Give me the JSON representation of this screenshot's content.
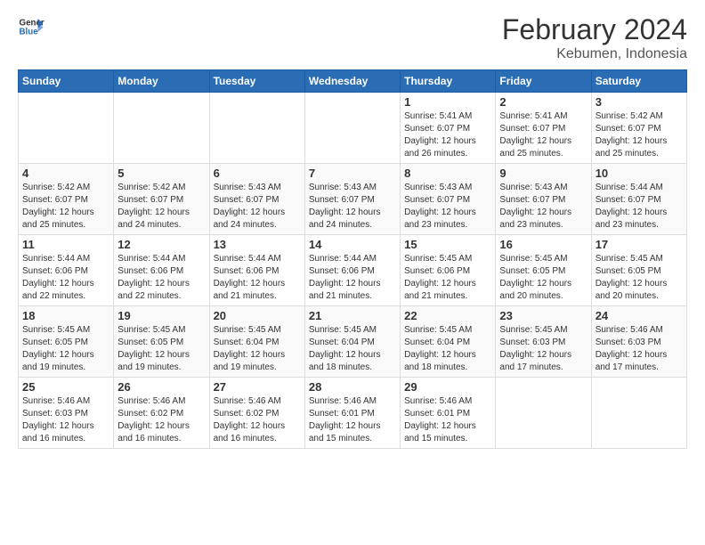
{
  "logo": {
    "line1": "General",
    "line2": "Blue"
  },
  "title": "February 2024",
  "location": "Kebumen, Indonesia",
  "days_of_week": [
    "Sunday",
    "Monday",
    "Tuesday",
    "Wednesday",
    "Thursday",
    "Friday",
    "Saturday"
  ],
  "weeks": [
    [
      {
        "day": "",
        "info": ""
      },
      {
        "day": "",
        "info": ""
      },
      {
        "day": "",
        "info": ""
      },
      {
        "day": "",
        "info": ""
      },
      {
        "day": "1",
        "info": "Sunrise: 5:41 AM\nSunset: 6:07 PM\nDaylight: 12 hours\nand 26 minutes."
      },
      {
        "day": "2",
        "info": "Sunrise: 5:41 AM\nSunset: 6:07 PM\nDaylight: 12 hours\nand 25 minutes."
      },
      {
        "day": "3",
        "info": "Sunrise: 5:42 AM\nSunset: 6:07 PM\nDaylight: 12 hours\nand 25 minutes."
      }
    ],
    [
      {
        "day": "4",
        "info": "Sunrise: 5:42 AM\nSunset: 6:07 PM\nDaylight: 12 hours\nand 25 minutes."
      },
      {
        "day": "5",
        "info": "Sunrise: 5:42 AM\nSunset: 6:07 PM\nDaylight: 12 hours\nand 24 minutes."
      },
      {
        "day": "6",
        "info": "Sunrise: 5:43 AM\nSunset: 6:07 PM\nDaylight: 12 hours\nand 24 minutes."
      },
      {
        "day": "7",
        "info": "Sunrise: 5:43 AM\nSunset: 6:07 PM\nDaylight: 12 hours\nand 24 minutes."
      },
      {
        "day": "8",
        "info": "Sunrise: 5:43 AM\nSunset: 6:07 PM\nDaylight: 12 hours\nand 23 minutes."
      },
      {
        "day": "9",
        "info": "Sunrise: 5:43 AM\nSunset: 6:07 PM\nDaylight: 12 hours\nand 23 minutes."
      },
      {
        "day": "10",
        "info": "Sunrise: 5:44 AM\nSunset: 6:07 PM\nDaylight: 12 hours\nand 23 minutes."
      }
    ],
    [
      {
        "day": "11",
        "info": "Sunrise: 5:44 AM\nSunset: 6:06 PM\nDaylight: 12 hours\nand 22 minutes."
      },
      {
        "day": "12",
        "info": "Sunrise: 5:44 AM\nSunset: 6:06 PM\nDaylight: 12 hours\nand 22 minutes."
      },
      {
        "day": "13",
        "info": "Sunrise: 5:44 AM\nSunset: 6:06 PM\nDaylight: 12 hours\nand 21 minutes."
      },
      {
        "day": "14",
        "info": "Sunrise: 5:44 AM\nSunset: 6:06 PM\nDaylight: 12 hours\nand 21 minutes."
      },
      {
        "day": "15",
        "info": "Sunrise: 5:45 AM\nSunset: 6:06 PM\nDaylight: 12 hours\nand 21 minutes."
      },
      {
        "day": "16",
        "info": "Sunrise: 5:45 AM\nSunset: 6:05 PM\nDaylight: 12 hours\nand 20 minutes."
      },
      {
        "day": "17",
        "info": "Sunrise: 5:45 AM\nSunset: 6:05 PM\nDaylight: 12 hours\nand 20 minutes."
      }
    ],
    [
      {
        "day": "18",
        "info": "Sunrise: 5:45 AM\nSunset: 6:05 PM\nDaylight: 12 hours\nand 19 minutes."
      },
      {
        "day": "19",
        "info": "Sunrise: 5:45 AM\nSunset: 6:05 PM\nDaylight: 12 hours\nand 19 minutes."
      },
      {
        "day": "20",
        "info": "Sunrise: 5:45 AM\nSunset: 6:04 PM\nDaylight: 12 hours\nand 19 minutes."
      },
      {
        "day": "21",
        "info": "Sunrise: 5:45 AM\nSunset: 6:04 PM\nDaylight: 12 hours\nand 18 minutes."
      },
      {
        "day": "22",
        "info": "Sunrise: 5:45 AM\nSunset: 6:04 PM\nDaylight: 12 hours\nand 18 minutes."
      },
      {
        "day": "23",
        "info": "Sunrise: 5:45 AM\nSunset: 6:03 PM\nDaylight: 12 hours\nand 17 minutes."
      },
      {
        "day": "24",
        "info": "Sunrise: 5:46 AM\nSunset: 6:03 PM\nDaylight: 12 hours\nand 17 minutes."
      }
    ],
    [
      {
        "day": "25",
        "info": "Sunrise: 5:46 AM\nSunset: 6:03 PM\nDaylight: 12 hours\nand 16 minutes."
      },
      {
        "day": "26",
        "info": "Sunrise: 5:46 AM\nSunset: 6:02 PM\nDaylight: 12 hours\nand 16 minutes."
      },
      {
        "day": "27",
        "info": "Sunrise: 5:46 AM\nSunset: 6:02 PM\nDaylight: 12 hours\nand 16 minutes."
      },
      {
        "day": "28",
        "info": "Sunrise: 5:46 AM\nSunset: 6:01 PM\nDaylight: 12 hours\nand 15 minutes."
      },
      {
        "day": "29",
        "info": "Sunrise: 5:46 AM\nSunset: 6:01 PM\nDaylight: 12 hours\nand 15 minutes."
      },
      {
        "day": "",
        "info": ""
      },
      {
        "day": "",
        "info": ""
      }
    ]
  ]
}
